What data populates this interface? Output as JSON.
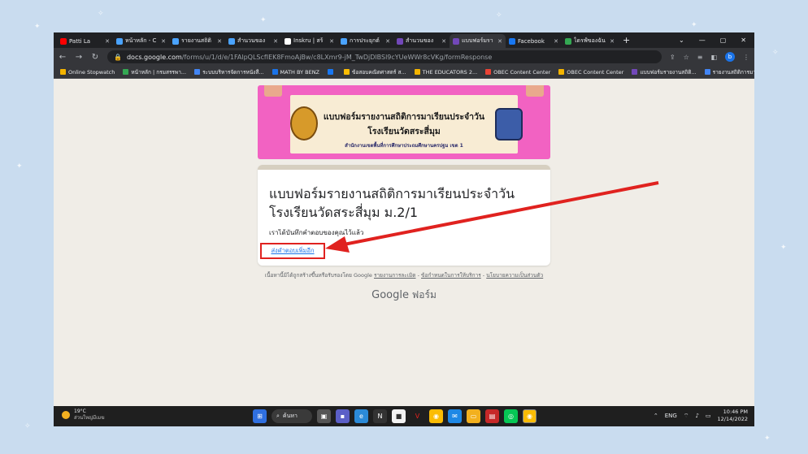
{
  "browser": {
    "tabs": [
      {
        "label": "Patti La",
        "icon": "youtube-icon",
        "color": "#ff0000"
      },
      {
        "label": "หน้าหลัก - C",
        "icon": "edge-icon",
        "color": "#4aa3ff"
      },
      {
        "label": "รายงานสถิติ",
        "icon": "edge-icon",
        "color": "#4aa3ff"
      },
      {
        "label": "สำนวนของ",
        "icon": "edge-icon",
        "color": "#4aa3ff"
      },
      {
        "label": "Inskru | สร้",
        "icon": "inskru-icon",
        "color": "#ffffff"
      },
      {
        "label": "การประยุกต์",
        "icon": "edge-icon",
        "color": "#4aa3ff"
      },
      {
        "label": "สำนวนของ",
        "icon": "forms-icon",
        "color": "#7248b9"
      },
      {
        "label": "แบบฟอร์มรา",
        "icon": "forms-icon",
        "color": "#7248b9"
      },
      {
        "label": "Facebook",
        "icon": "facebook-icon",
        "color": "#1877f2"
      },
      {
        "label": "ไดรฟ์ของฉัน",
        "icon": "drive-icon",
        "color": "#34a853"
      }
    ],
    "active_tab_index": 7,
    "new_tab": "+",
    "url_host": "docs.google.com",
    "url_path": "/forms/u/1/d/e/1FAlpQLScfIEK8FmoAjBw/c8LXmr9-jM_TwDjDlBSl9cYUeWWr8cVKg/formResponse",
    "profile_initial": "b",
    "bookmarks": [
      {
        "label": "Online Stopwatch",
        "color": "#f4b400"
      },
      {
        "label": "หน้าหลัก | กรมสรรพา...",
        "color": "#34a853"
      },
      {
        "label": "ระบบบริหารจัดการหนังสื...",
        "color": "#4285f4"
      },
      {
        "label": "MATH BY BENZ",
        "color": "#1a73e8"
      },
      {
        "label": "",
        "color": "#1877f2"
      },
      {
        "label": "ข้อสอบคณิตศาสตร์ ส...",
        "color": "#fbbc04"
      },
      {
        "label": "THE EDUCATORS 2...",
        "color": "#f4b400"
      },
      {
        "label": "OBEC Content Center",
        "color": "#ea4335"
      },
      {
        "label": "OBEC Content Center",
        "color": "#f4b400"
      },
      {
        "label": "แบบฟอร์มรายงานสถิติ...",
        "color": "#7248b9"
      },
      {
        "label": "รายงานสถิติการมาเรีย...",
        "color": "#4285f4"
      }
    ]
  },
  "banner": {
    "line1": "แบบฟอร์มรายงานสถิติการมาเรียนประจำวัน",
    "line2": "โรงเรียนวัดสระสี่มุม",
    "line3": "สำนักงานเขตพื้นที่การศึกษาประถมศึกษานครปฐม เขต 1"
  },
  "form": {
    "title_line1": "แบบฟอร์มรายงานสถิติการมาเรียนประจำวัน",
    "title_line2": "โรงเรียนวัดสระสี่มุม ม.2/1",
    "confirmation": "เราได้บันทึกคำตอบของคุณไว้แล้ว",
    "submit_another": "ส่งคำตอบเพิ่มอีก"
  },
  "footer": {
    "note": "เนื้อหานี้มิได้ถูกสร้างขึ้นหรือรับรองโดย Google",
    "report_abuse": "รายงานการละเมิด",
    "terms": "ข้อกำหนดในการให้บริการ",
    "privacy": "นโยบายความเป็นส่วนตัว",
    "sep": " - ",
    "brand_google": "Google",
    "brand_forms": "ฟอร์ม"
  },
  "taskbar": {
    "temperature": "19°C",
    "weather_desc": "ส่วนใหญ่มีเมฆ",
    "search_label": "ค้นหา",
    "lang": "ENG",
    "time": "10:46 PM",
    "date": "12/14/2022"
  },
  "colors": {
    "annotation_arrow": "#e0221f",
    "banner_pink": "#f262c2"
  }
}
